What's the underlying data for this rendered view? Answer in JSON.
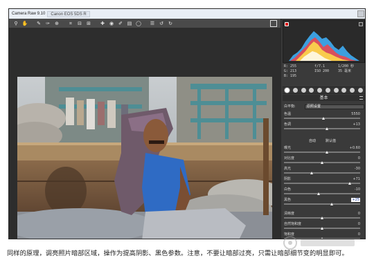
{
  "window": {
    "title": "Camera Raw 9.10",
    "camera": "Canon EOS 5DS R"
  },
  "toolbar": {
    "tools": [
      "zoom-icon",
      "hand-icon",
      "white-balance-icon",
      "color-sampler-icon",
      "targeted-adjust-icon",
      "crop-icon",
      "straighten-icon",
      "transform-icon",
      "spot-removal-icon",
      "red-eye-icon",
      "adjustment-brush-icon",
      "graduated-filter-icon",
      "radial-filter-icon",
      "presets-icon",
      "rotate-ccw-icon",
      "rotate-cw-icon"
    ],
    "glyphs": [
      "⚲",
      "✋",
      "✎",
      "✑",
      "⊕",
      "⌗",
      "⊟",
      "⊞",
      "✚",
      "◉",
      "✐",
      "▤",
      "◯",
      "☰",
      "↺",
      "↻"
    ]
  },
  "readout": {
    "r": "R: 255",
    "g": "G: 213",
    "b": "B: 195",
    "exposure": "f/7.1",
    "shutter": "1/200 秒",
    "iso": "ISO 200",
    "lens": "35 毫米"
  },
  "panel": {
    "section": "基本",
    "wb_label": "白平衡:",
    "wb_value": "原照设置",
    "auto": "自动",
    "default": "默认值",
    "sliders": [
      {
        "label": "色温",
        "value": "5550",
        "pos": 0.52
      },
      {
        "label": "色调",
        "value": "+13",
        "pos": 0.56
      },
      {
        "label": "曝光",
        "value": "+0.60",
        "pos": 0.56
      },
      {
        "label": "对比度",
        "value": "0",
        "pos": 0.5
      },
      {
        "label": "高光",
        "value": "-30",
        "pos": 0.36
      },
      {
        "label": "阴影",
        "value": "+71",
        "pos": 0.86
      },
      {
        "label": "白色",
        "value": "-10",
        "pos": 0.45
      },
      {
        "label": "黑色",
        "value": "+25",
        "pos": 0.63,
        "highlight": true
      },
      {
        "label": "清晰度",
        "value": "0",
        "pos": 0.5
      },
      {
        "label": "自然饱和度",
        "value": "0",
        "pos": 0.5
      },
      {
        "label": "饱和度",
        "value": "0",
        "pos": 0.5
      }
    ]
  },
  "caption": "同样的原理，调亮照片暗部区域，操作为提高阴影、黑色参数。注意，不要让暗部过亮，只需让暗部细节变的明显即可。"
}
